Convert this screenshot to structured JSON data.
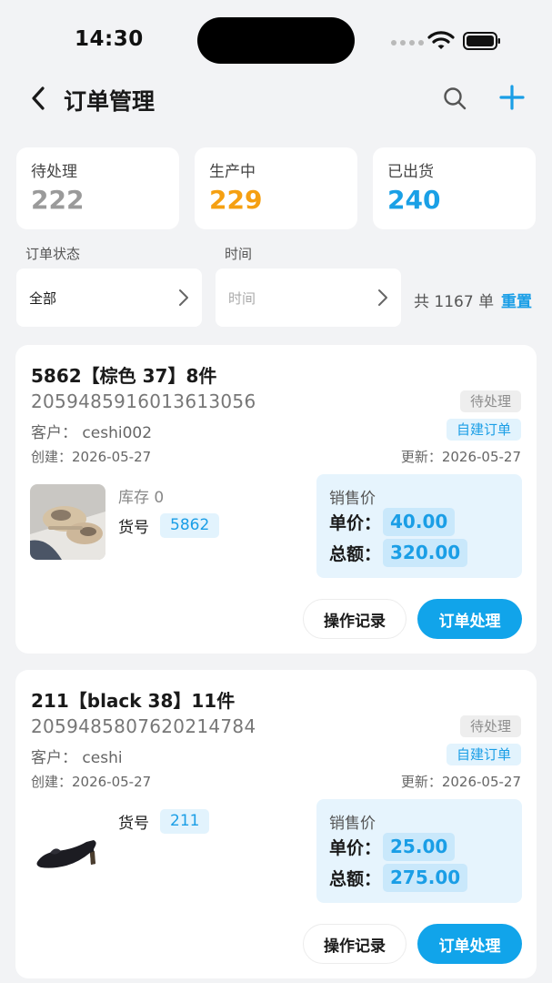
{
  "status_bar": {
    "time": "14:30"
  },
  "nav": {
    "title": "订单管理"
  },
  "summary": [
    {
      "label": "待处理",
      "value": "222",
      "color": "#9a9a9a"
    },
    {
      "label": "生产中",
      "value": "229",
      "color": "#f5a012"
    },
    {
      "label": "已出货",
      "value": "240",
      "color": "#1aa0e6"
    }
  ],
  "filters": {
    "status_label": "订单状态",
    "status_value": "全部",
    "time_label": "时间",
    "time_placeholder": "时间",
    "count_text": "共 1167 单",
    "reset_label": "重置"
  },
  "orders": [
    {
      "title": "5862【棕色 37】8件",
      "order_no": "2059485916013613056",
      "status": "待处理",
      "type": "自建订单",
      "customer": "客户：  ceshi002",
      "created": "创建：2026-05-27",
      "updated": "更新：2026-05-27",
      "stock": "库存 0",
      "sku_label": "货号",
      "sku": "5862",
      "price_label": "销售价",
      "unit_label": "单价：",
      "unit_price": "40.00",
      "total_label": "总额：",
      "total": "320.00",
      "log_button": "操作记录",
      "process_button": "订单处理"
    },
    {
      "title": "211【black 38】11件",
      "order_no": "2059485807620214784",
      "status": "待处理",
      "type": "自建订单",
      "customer": "客户：  ceshi",
      "created": "创建：2026-05-27",
      "updated": "更新：2026-05-27",
      "sku_label": "货号",
      "sku": "211",
      "price_label": "销售价",
      "unit_label": "单价：",
      "unit_price": "25.00",
      "total_label": "总额：",
      "total": "275.00",
      "log_button": "操作记录",
      "process_button": "订单处理"
    }
  ],
  "colors": {
    "accent": "#11a4ea",
    "background": "#f2f3f5"
  }
}
